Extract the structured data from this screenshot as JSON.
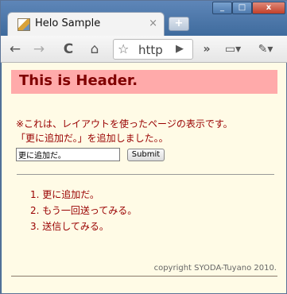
{
  "window": {
    "tab_title": "Helo Sample",
    "tab_close": "×",
    "new_tab": "+",
    "controls": {
      "minimize": "_",
      "maximize": "□",
      "close": "x"
    }
  },
  "toolbar": {
    "back": "←",
    "forward": "→",
    "reload": "C",
    "home": "⌂",
    "star": "☆",
    "address_text": "http",
    "go": "▶",
    "more": "»",
    "page": "▭▾",
    "tools": "✎▾"
  },
  "page": {
    "header": "This is Header.",
    "message_line1": "※これは、レイアウトを使ったページの表示です。",
    "message_line2": "「更に追加だ。」を追加しました。。",
    "input_value": "更に追加だ。",
    "submit_label": "Submit",
    "items": [
      "1.  更に追加だ。",
      "2.  もう一回送ってみる。",
      "3.  送信してみる。"
    ],
    "footer": "copyright SYODA-Tuyano 2010."
  },
  "colors": {
    "header_bg": "#ffaaaa",
    "header_text": "#800000",
    "page_bg": "#fffbe6",
    "message_text": "#990000"
  }
}
